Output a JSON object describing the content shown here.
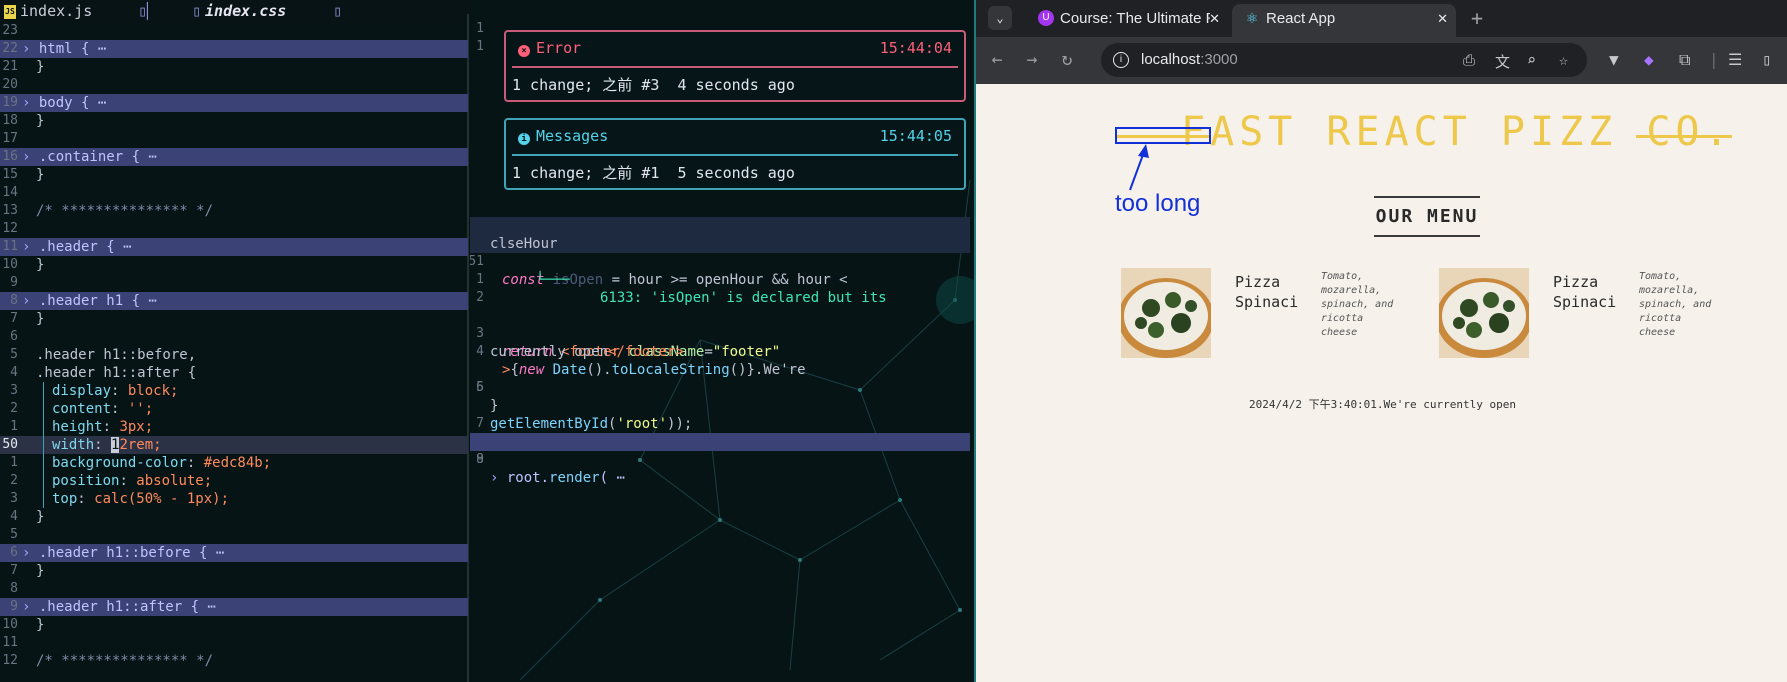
{
  "editor": {
    "tabs": [
      {
        "label": "index.js",
        "icon": "js-file-icon",
        "active": false
      },
      {
        "label": "index.css",
        "icon": "css-file-icon",
        "active": true
      }
    ],
    "left_lines": [
      {
        "ln": "23",
        "text": ""
      },
      {
        "ln": "22",
        "text": "html { ⋯",
        "fold": true
      },
      {
        "ln": "21",
        "text": "}"
      },
      {
        "ln": "20",
        "text": ""
      },
      {
        "ln": "19",
        "text": "body { ⋯",
        "fold": true
      },
      {
        "ln": "18",
        "text": "}"
      },
      {
        "ln": "17",
        "text": ""
      },
      {
        "ln": "16",
        "text": ".container { ⋯",
        "fold": true
      },
      {
        "ln": "15",
        "text": "}"
      },
      {
        "ln": "14",
        "text": ""
      },
      {
        "ln": "13",
        "text": "/* *************** */",
        "comment": true
      },
      {
        "ln": "12",
        "text": ""
      },
      {
        "ln": "11",
        "text": ".header { ⋯",
        "fold": true
      },
      {
        "ln": "10",
        "text": "}"
      },
      {
        "ln": "9",
        "text": ""
      },
      {
        "ln": "8",
        "text": ".header h1 { ⋯",
        "fold": true
      },
      {
        "ln": "7",
        "text": "}"
      },
      {
        "ln": "6",
        "text": ""
      },
      {
        "ln": "5",
        "text": ".header h1::before,"
      },
      {
        "ln": "4",
        "text": ".header h1::after {"
      },
      {
        "ln": "3",
        "prop": "display",
        "val": "block;"
      },
      {
        "ln": "2",
        "prop": "content",
        "val": "'';"
      },
      {
        "ln": "1",
        "prop": "height",
        "val": "3px;"
      },
      {
        "ln": "50",
        "prop": "width",
        "val": "12rem;",
        "current": true
      },
      {
        "ln": "1",
        "prop": "background-color",
        "val": "#edc84b;"
      },
      {
        "ln": "2",
        "prop": "position",
        "val": "absolute;"
      },
      {
        "ln": "3",
        "prop": "top",
        "val": "calc(50% - 1px);"
      },
      {
        "ln": "4",
        "text": "}"
      },
      {
        "ln": "5",
        "text": ""
      },
      {
        "ln": "6",
        "text": ".header h1::before { ⋯",
        "fold": true
      },
      {
        "ln": "7",
        "text": "}"
      },
      {
        "ln": "8",
        "text": ""
      },
      {
        "ln": "9",
        "text": ".header h1::after { ⋯",
        "fold": true
      },
      {
        "ln": "10",
        "text": "}"
      },
      {
        "ln": "11",
        "text": ""
      },
      {
        "ln": "12",
        "text": "/* *************** */",
        "comment": true
      }
    ],
    "right": {
      "error": {
        "title": "Error",
        "time": "15:44:04",
        "body": "1 change; 之前 #3  4 seconds ago"
      },
      "messages": {
        "title": "Messages",
        "time": "15:44:05",
        "body": "1 change; 之前 #1  5 seconds ago"
      },
      "top_ln": [
        "1",
        "1"
      ],
      "diagnostic": "6133: 'isOpen' is declared but its",
      "bottom_ln": [
        "1",
        "51",
        "1",
        "2",
        "3",
        "4",
        "5",
        "6",
        "7",
        "8",
        "9"
      ]
    }
  },
  "browser": {
    "tabs": [
      {
        "title": "Course: The Ultimate React",
        "icon": "udemy-icon"
      },
      {
        "title": "React App",
        "icon": "react-icon"
      }
    ],
    "url_host": "localhost",
    "url_port": ":3000",
    "page": {
      "logo": "FAST REACT PIZZ CO.",
      "annotation": "too long",
      "menu_title": "OUR MENU",
      "pizzas": [
        {
          "name_1": "Pizza",
          "name_2": "Spinaci",
          "ingredients": [
            "Tomato,",
            "mozarella,",
            "spinach, and",
            "ricotta",
            "cheese"
          ]
        },
        {
          "name_1": "Pizza",
          "name_2": "Spinaci",
          "ingredients": [
            "Tomato,",
            "mozarella,",
            "spinach, and",
            "ricotta",
            "cheese"
          ]
        }
      ],
      "footer": "2024/4/2 下午3:40:01.We're currently open"
    },
    "colors": {
      "accent": "#edc84b",
      "annotation": "#1230d8"
    }
  }
}
